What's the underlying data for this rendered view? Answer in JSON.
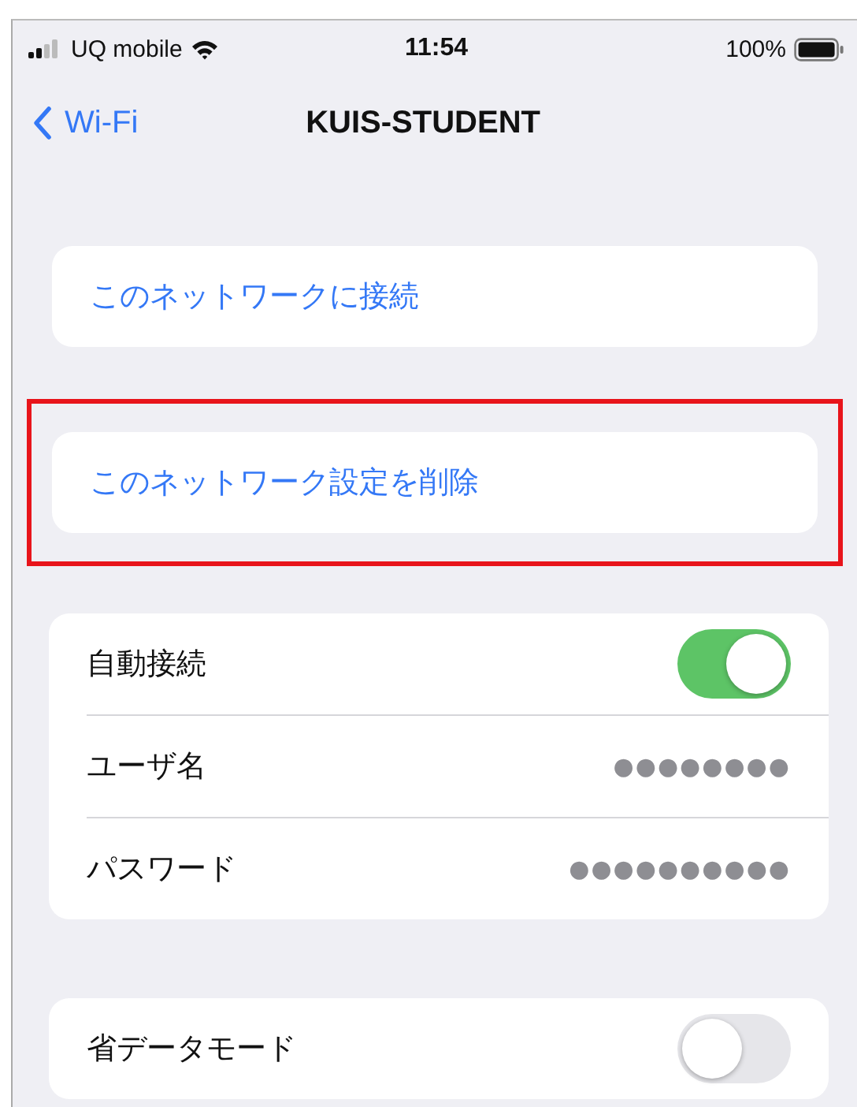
{
  "status_bar": {
    "carrier": "UQ mobile",
    "time": "11:54",
    "battery": "100%"
  },
  "nav": {
    "back": "Wi-Fi",
    "title": "KUIS-STUDENT"
  },
  "actions": [
    {
      "label": "このネットワークに接続",
      "highlighted": false
    },
    {
      "label": "このネットワーク設定を削除",
      "highlighted": true
    }
  ],
  "settings": [
    {
      "kind": "toggle",
      "label": "自動接続",
      "on": true
    },
    {
      "kind": "value",
      "label": "ユーザ名",
      "value": "●●●●●●●●"
    },
    {
      "kind": "value",
      "label": "パスワード",
      "value": "●●●●●●●●●●"
    }
  ],
  "data_mode": [
    {
      "kind": "toggle",
      "label": "省データモード",
      "on": false
    }
  ]
}
